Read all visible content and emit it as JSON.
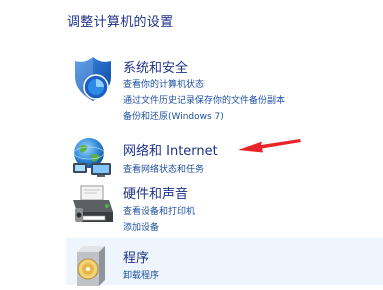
{
  "page": {
    "title": "调整计算机的设置"
  },
  "categories": [
    {
      "title": "系统和安全",
      "icon": "shield-icon",
      "links": [
        "查看你的计算机状态",
        "通过文件历史记录保存你的文件备份副本",
        "备份和还原(Windows 7)"
      ]
    },
    {
      "title": "网络和 Internet",
      "icon": "network-globe-icon",
      "links": [
        "查看网络状态和任务"
      ]
    },
    {
      "title": "硬件和声音",
      "icon": "printer-icon",
      "links": [
        "查看设备和打印机",
        "添加设备"
      ]
    },
    {
      "title": "程序",
      "icon": "programs-disc-icon",
      "links": [
        "卸载程序"
      ]
    }
  ],
  "annotation": {
    "arrow_color": "#e8262a"
  }
}
